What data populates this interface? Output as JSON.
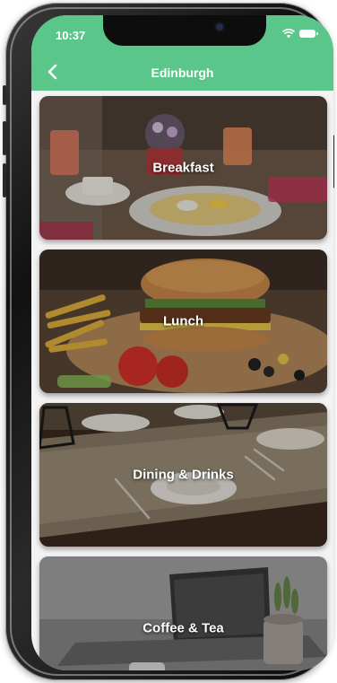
{
  "status": {
    "time": "10:37"
  },
  "header": {
    "title": "Edinburgh"
  },
  "categories": [
    {
      "label": "Breakfast"
    },
    {
      "label": "Lunch"
    },
    {
      "label": "Dining & Drinks"
    },
    {
      "label": "Coffee & Tea"
    }
  ],
  "colors": {
    "accent": "#5ac68a"
  },
  "icons": {
    "back": "chevron-left-icon",
    "wifi": "wifi-icon",
    "battery": "battery-icon"
  }
}
